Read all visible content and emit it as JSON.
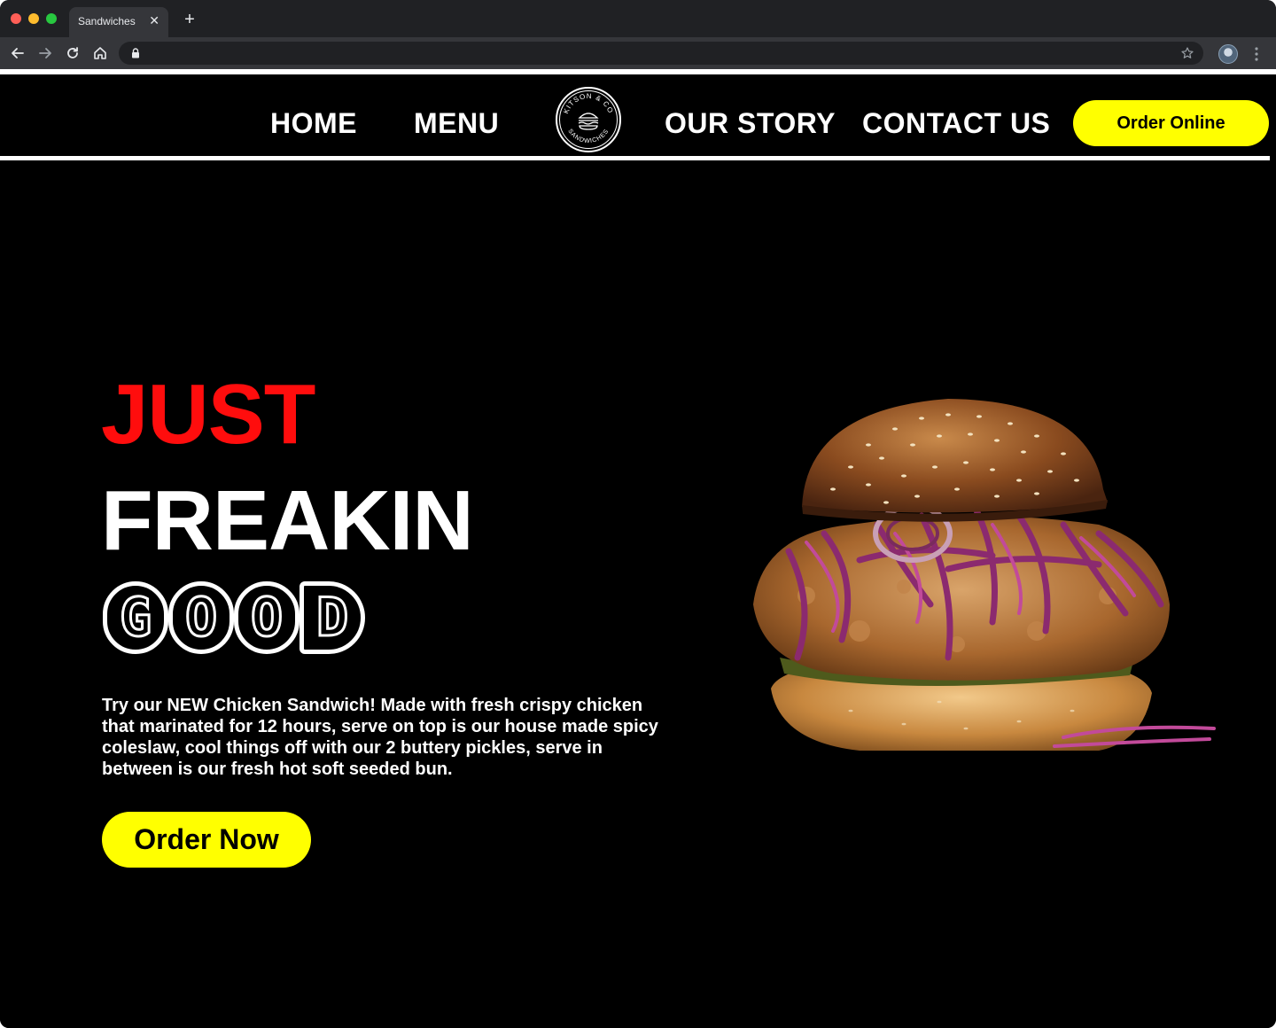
{
  "browser": {
    "tab_title": "Sandwiches",
    "tab_close": "✕",
    "new_tab": "+",
    "address": ""
  },
  "nav": {
    "home": "HOME",
    "menu": "MENU",
    "logo_text_top": "KITSON & CO",
    "logo_text_bottom": "SANDWICHES",
    "our_story": "OUR STORY",
    "contact_us": "CONTACT US",
    "order_online": "Order Online"
  },
  "hero": {
    "line1": "JUST",
    "line2": "FREAKIN",
    "line3_letters": [
      "G",
      "O",
      "O",
      "D"
    ],
    "description": "Try our NEW Chicken Sandwich! Made with  fresh crispy chicken that marinated for 12 hours, serve on top is our house made spicy coleslaw, cool things off with our 2 buttery pickles, serve in between is our fresh hot soft seeded bun.",
    "order_now": "Order Now"
  },
  "colors": {
    "accent_yellow": "#ffff00",
    "headline_red": "#ff0d0d",
    "background": "#000000",
    "text": "#ffffff"
  },
  "icons": [
    "back-arrow-icon",
    "forward-arrow-icon",
    "reload-icon",
    "home-icon",
    "lock-icon",
    "star-icon",
    "profile-avatar",
    "more-options-icon",
    "logo-burger-icon",
    "burger-image"
  ]
}
